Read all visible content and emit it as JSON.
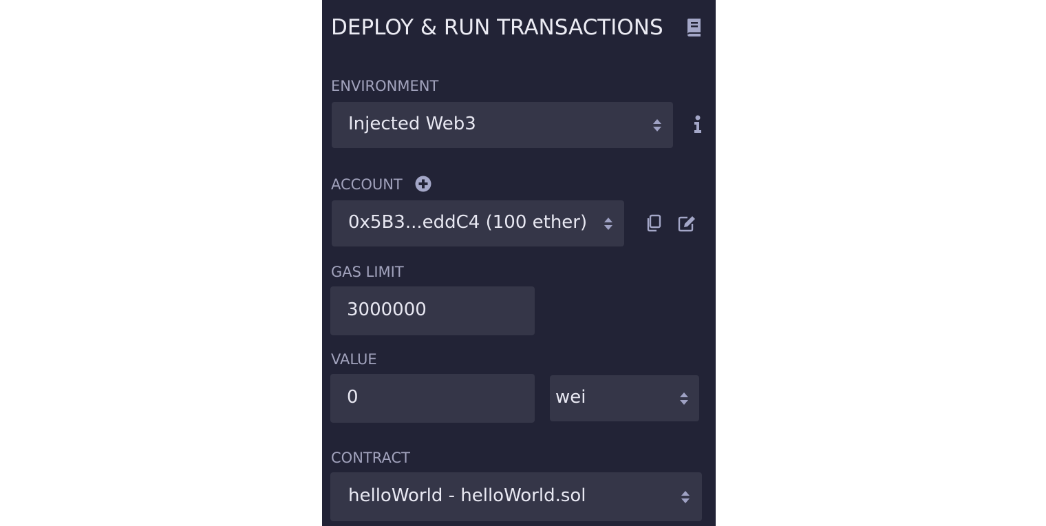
{
  "header": {
    "title": "DEPLOY & RUN TRANSACTIONS",
    "icon": "book-icon"
  },
  "environment": {
    "label": "ENVIRONMENT",
    "selected": "Injected Web3",
    "info_icon": "info-icon"
  },
  "account": {
    "label": "ACCOUNT",
    "selected": "0x5B3...eddC4 (100 ether)",
    "add_icon": "plus-circle-icon",
    "copy_icon": "copy-icon",
    "edit_icon": "edit-icon"
  },
  "gas_limit": {
    "label": "GAS LIMIT",
    "value": "3000000"
  },
  "value": {
    "label": "VALUE",
    "amount": "0",
    "unit": "wei"
  },
  "contract": {
    "label": "CONTRACT",
    "selected": "helloWorld - helloWorld.sol"
  },
  "colors": {
    "panel_bg": "#222336",
    "field_bg": "#353648",
    "label": "#a2a3bd",
    "text": "#e8e8f2",
    "icon": "#9fa2c4"
  }
}
